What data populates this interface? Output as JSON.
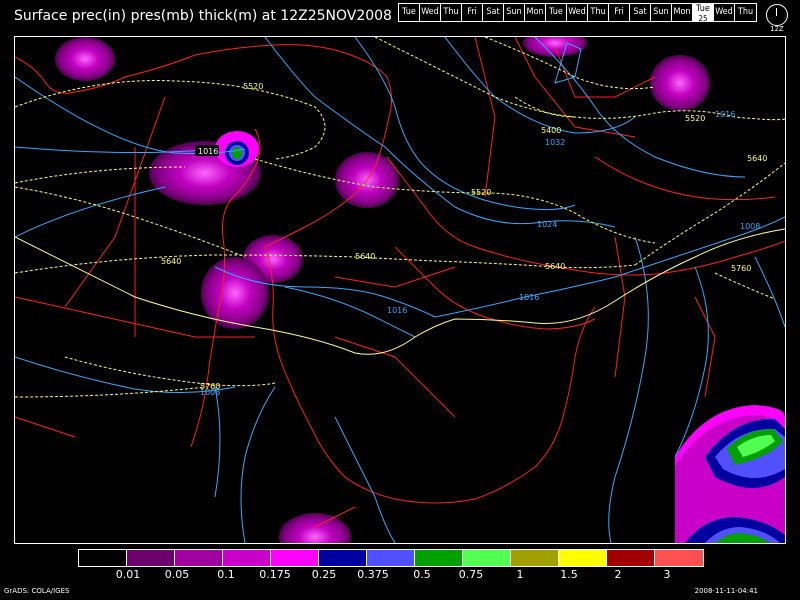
{
  "title": "Surface prec(in) pres(mb) thick(m) at 12Z25NOV2008",
  "day_strip": {
    "days": [
      "Tue",
      "Wed",
      "Thu",
      "Fri",
      "Sat",
      "Sun",
      "Mon",
      "Tue",
      "Wed",
      "Thu",
      "Fri",
      "Sat",
      "Sun",
      "Mon",
      "Tue",
      "Wed",
      "Thu"
    ],
    "current_index": 14,
    "current_sub": "25"
  },
  "clock_label": "12Z",
  "legend": {
    "colors": [
      "#000000",
      "#6e006e",
      "#a000a0",
      "#c800c8",
      "#ff00ff",
      "#0000a0",
      "#5050ff",
      "#00a000",
      "#50ff50",
      "#a0a000",
      "#ffff00",
      "#a00000",
      "#ff5050"
    ],
    "labels": [
      "0.01",
      "0.05",
      "0.1",
      "0.175",
      "0.25",
      "0.375",
      "0.5",
      "0.75",
      "1",
      "1.5",
      "2",
      "3"
    ]
  },
  "map": {
    "thickness_color": "#ffff66",
    "isobar_color": "#33aaff",
    "coast_color": "#ff2020",
    "thickness_labels": [
      "5520",
      "5640",
      "5520",
      "5640",
      "5640",
      "5640",
      "5760",
      "5760",
      "5520",
      "5400"
    ],
    "isobar_labels": [
      "1016",
      "1032",
      "1024",
      "1016",
      "1016",
      "1008",
      "1016",
      "1008"
    ]
  },
  "footer_left": "GrADS: COLA/IGES",
  "footer_right": "2008-11-11-04:41"
}
